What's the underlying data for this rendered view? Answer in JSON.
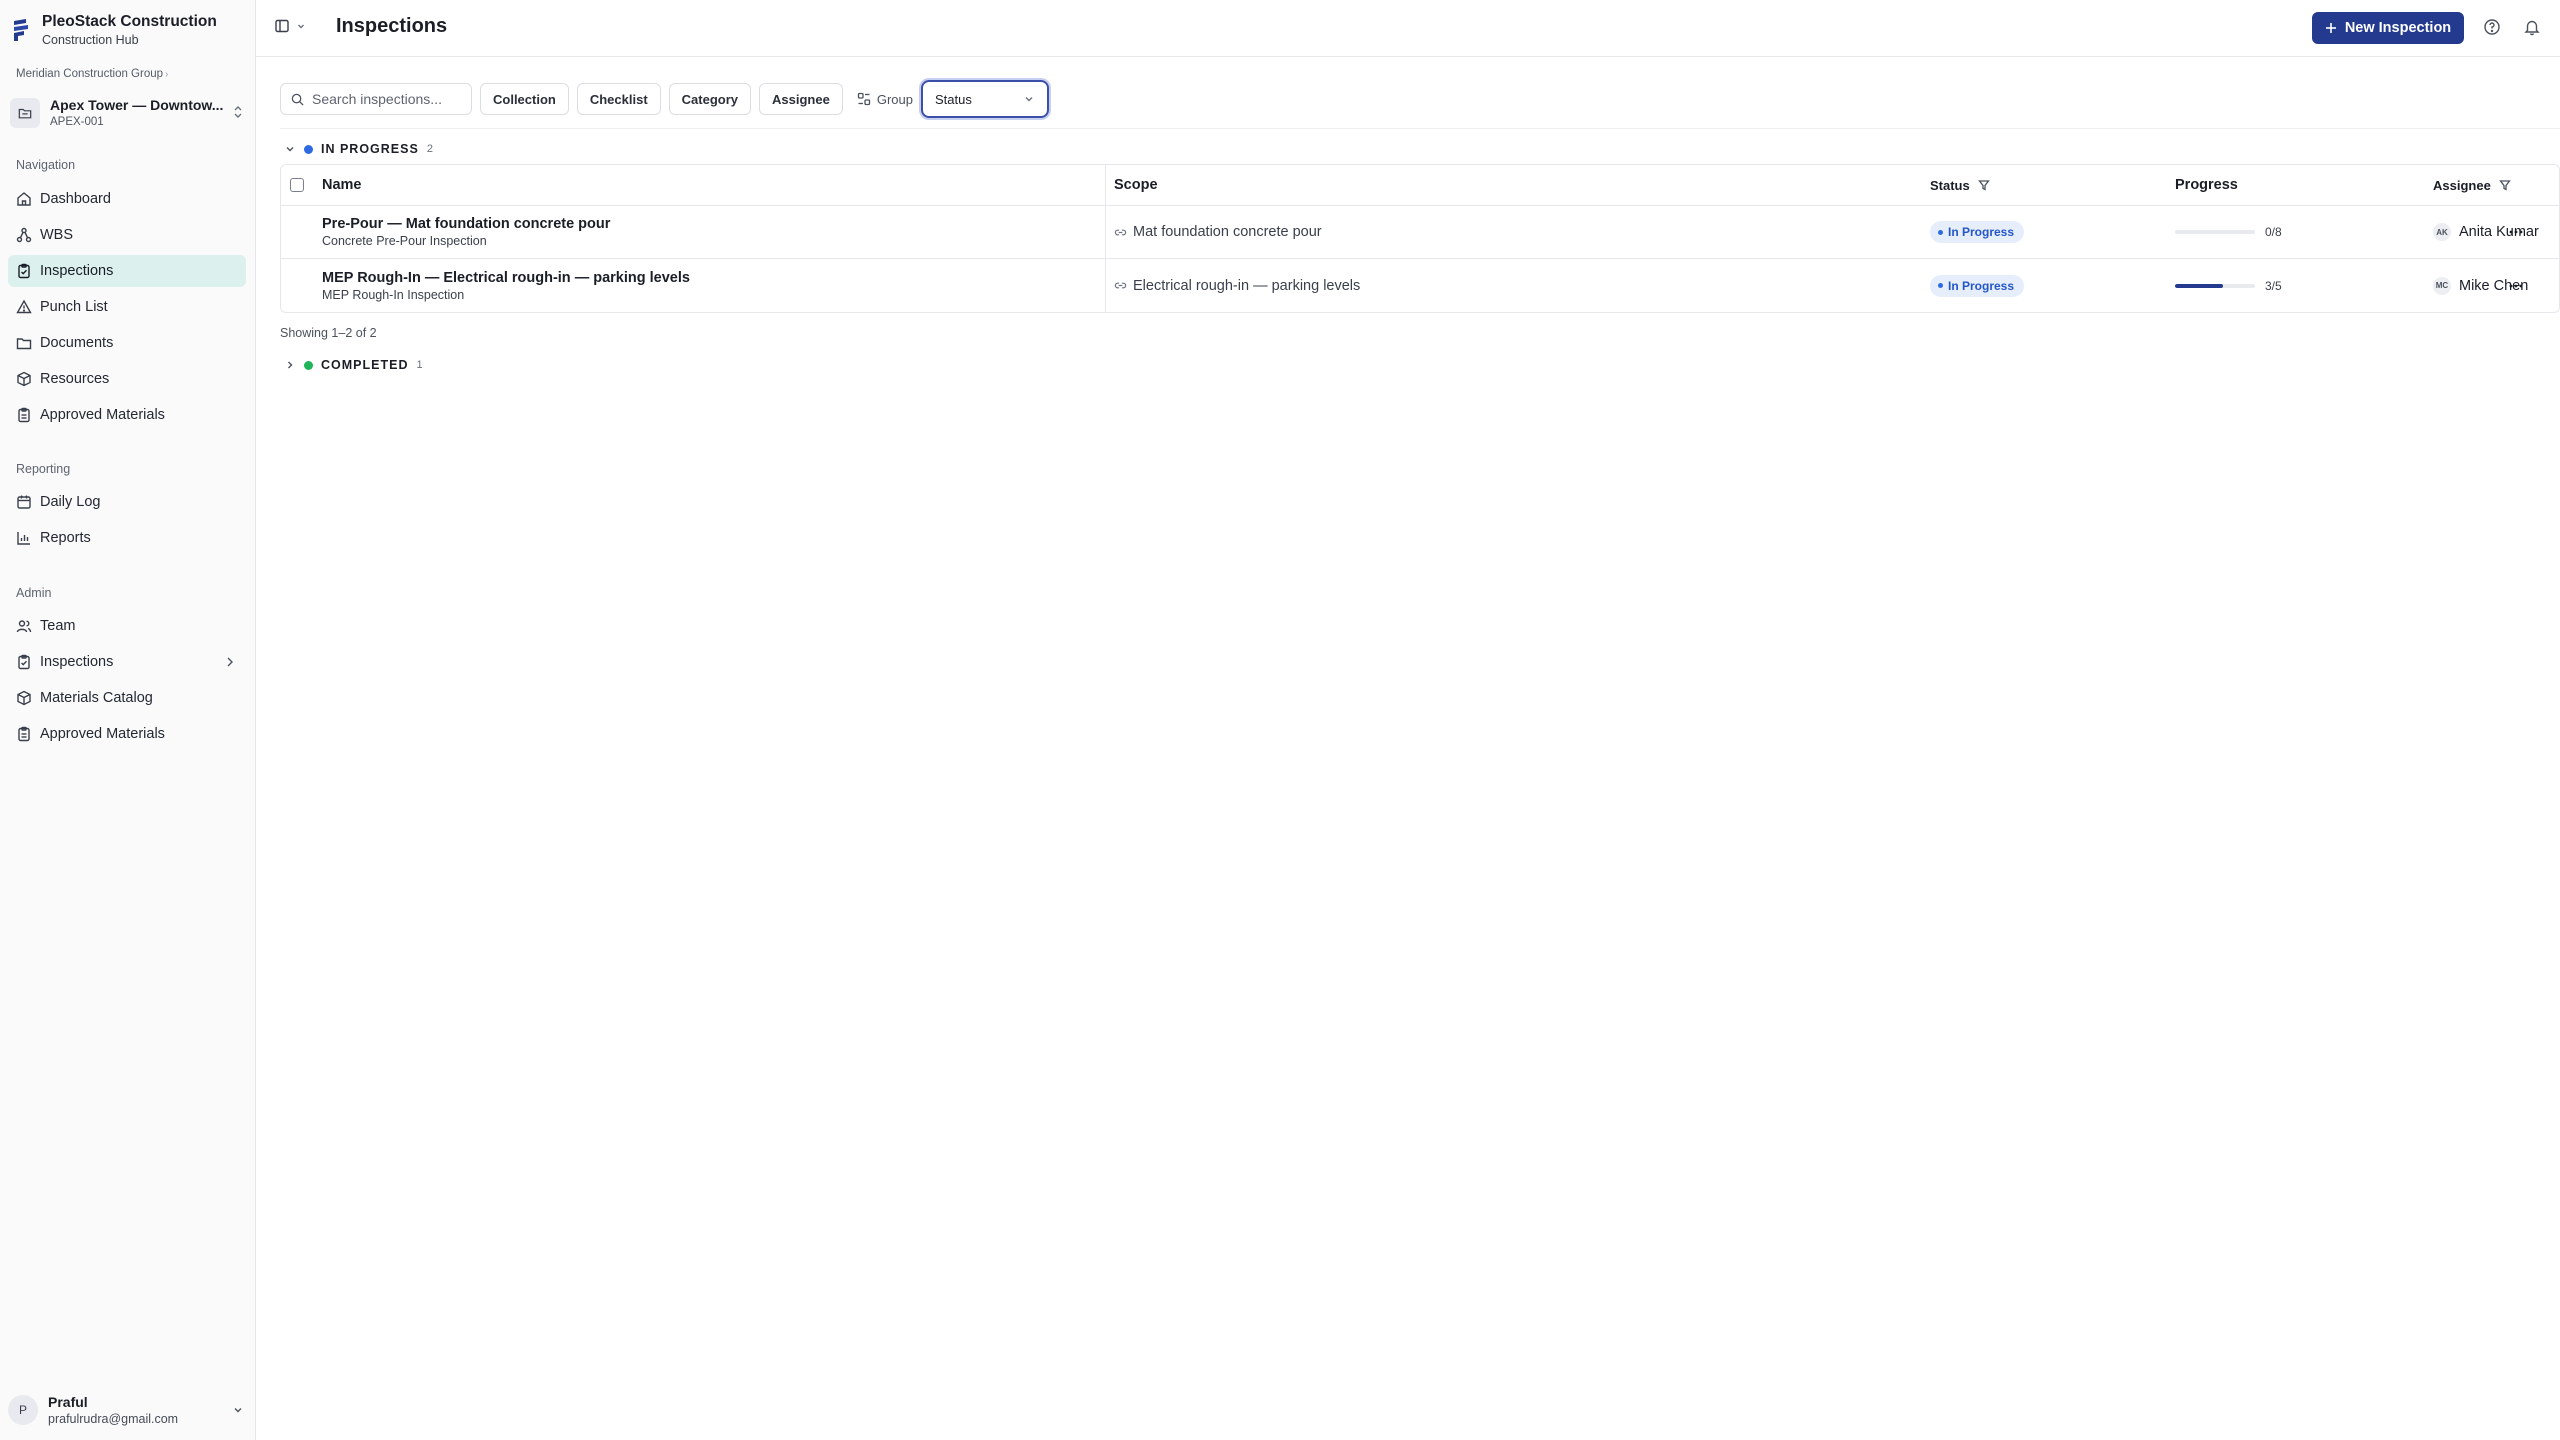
{
  "brand": {
    "name": "PleoStack Construction",
    "subtitle": "Construction Hub"
  },
  "org": {
    "name": "Meridian Construction Group"
  },
  "project": {
    "name": "Apex Tower — Downtow...",
    "code": "APEX-001"
  },
  "sidebar": {
    "sections": [
      {
        "label": "Navigation",
        "items": [
          {
            "label": "Dashboard",
            "icon": "home-icon"
          },
          {
            "label": "WBS",
            "icon": "hierarchy-icon"
          },
          {
            "label": "Inspections",
            "icon": "clipboard-check-icon",
            "active": true
          },
          {
            "label": "Punch List",
            "icon": "warning-icon"
          },
          {
            "label": "Documents",
            "icon": "folder-icon"
          },
          {
            "label": "Resources",
            "icon": "cube-icon"
          },
          {
            "label": "Approved Materials",
            "icon": "clipboard-icon"
          }
        ]
      },
      {
        "label": "Reporting",
        "items": [
          {
            "label": "Daily Log",
            "icon": "calendar-icon"
          },
          {
            "label": "Reports",
            "icon": "bar-chart-icon"
          }
        ]
      },
      {
        "label": "Admin",
        "items": [
          {
            "label": "Team",
            "icon": "users-icon"
          },
          {
            "label": "Inspections",
            "icon": "clipboard-check-icon",
            "has_submenu": true
          },
          {
            "label": "Materials Catalog",
            "icon": "cube-icon"
          },
          {
            "label": "Approved Materials",
            "icon": "clipboard-icon"
          }
        ]
      }
    ]
  },
  "user": {
    "initial": "P",
    "name": "Praful",
    "email": "prafulrudra@gmail.com"
  },
  "header": {
    "title": "Inspections",
    "new_button": "New Inspection"
  },
  "filters": {
    "search_placeholder": "Search inspections...",
    "chips": [
      "Collection",
      "Checklist",
      "Category",
      "Assignee"
    ],
    "group_label": "Group",
    "group_value": "Status"
  },
  "groups": [
    {
      "name": "IN PROGRESS",
      "count": "2",
      "color": "#2f6be0",
      "expanded": true
    },
    {
      "name": "COMPLETED",
      "count": "1",
      "color": "#1fb35a",
      "expanded": false
    }
  ],
  "table": {
    "columns": {
      "name": "Name",
      "scope": "Scope",
      "status": "Status",
      "progress": "Progress",
      "assignee": "Assignee"
    },
    "rows": [
      {
        "title": "Pre-Pour — Mat foundation concrete pour",
        "subtitle": "Concrete Pre-Pour Inspection",
        "scope": "Mat foundation concrete pour",
        "status": "In Progress",
        "progress_text": "0/8",
        "progress_fraction": 0,
        "assignee_initials": "AK",
        "assignee": "Anita Kumar"
      },
      {
        "title": "MEP Rough-In — Electrical rough-in — parking levels",
        "subtitle": "MEP Rough-In Inspection",
        "scope": "Electrical rough-in — parking levels",
        "status": "In Progress",
        "progress_text": "3/5",
        "progress_fraction": 0.6,
        "assignee_initials": "MC",
        "assignee": "Mike Chen"
      }
    ]
  },
  "pagination": {
    "showing": "Showing 1–2 of 2"
  },
  "colors": {
    "accent": "#243a8f",
    "active_nav": "#dcf1ee",
    "in_progress": "#2f6be0",
    "completed": "#1fb35a"
  }
}
